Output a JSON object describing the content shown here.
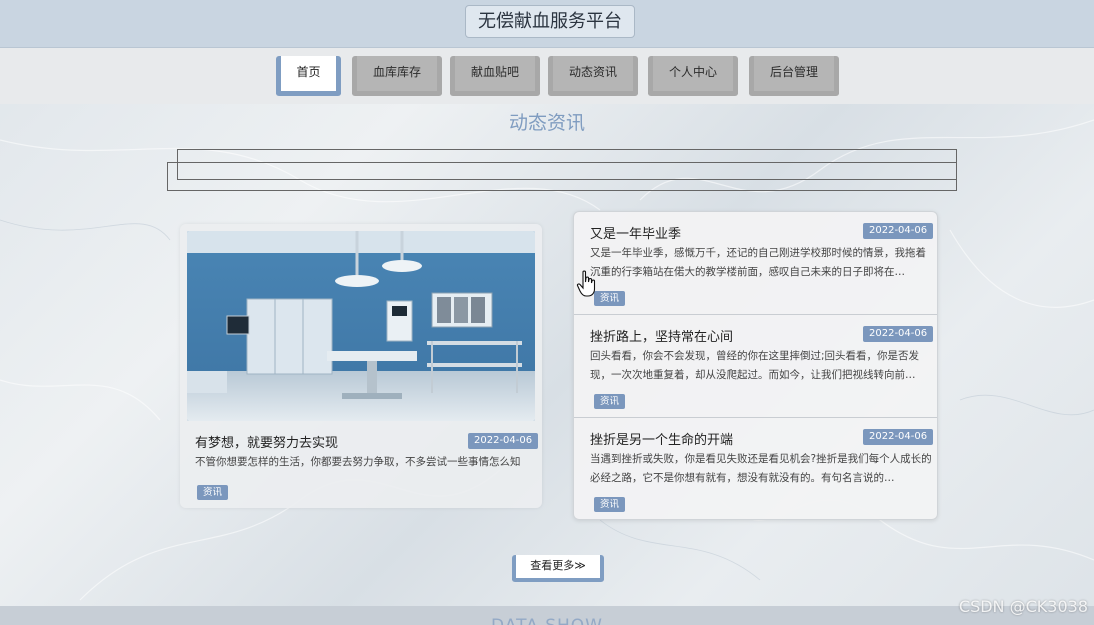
{
  "header": {
    "site_title": "无偿献血服务平台"
  },
  "nav": {
    "items": [
      {
        "label": "首页",
        "active": true
      },
      {
        "label": "血库库存",
        "active": false
      },
      {
        "label": "献血贴吧",
        "active": false
      },
      {
        "label": "动态资讯",
        "active": false
      },
      {
        "label": "个人中心",
        "active": false
      },
      {
        "label": "后台管理",
        "active": false
      }
    ]
  },
  "news": {
    "section_title": "动态资讯",
    "featured": {
      "title": "有梦想，就要努力去实现",
      "date": "2022-04-06",
      "summary": "不管你想要怎样的生活，你都要去努力争取，不多尝试一些事情怎么知",
      "tag": "资讯",
      "image": "operating-room-photo"
    },
    "list": [
      {
        "title": "又是一年毕业季",
        "date": "2022-04-06",
        "summary": "又是一年毕业季，感慨万千，还记的自己刚进学校那时候的情景，我拖着沉重的行李箱站在偌大的教学楼前面，感叹自己未来的日子即将在…",
        "tag": "资讯"
      },
      {
        "title": "挫折路上，坚持常在心间",
        "date": "2022-04-06",
        "summary": "回头看看，你会不会发现，曾经的你在这里摔倒过;回头看看，你是否发现，一次次地重复着，却从没爬起过。而如今，让我们把视线转向前…",
        "tag": "资讯"
      },
      {
        "title": "挫折是另一个生命的开端",
        "date": "2022-04-06",
        "summary": "当遇到挫折或失败，你是看见失败还是看见机会?挫折是我们每个人成长的必经之路，它不是你想有就有，想没有就没有的。有句名言说的…",
        "tag": "资讯"
      }
    ],
    "more_label": "查看更多≫"
  },
  "footer": {
    "section_title": "DATA SHOW"
  },
  "watermark": "CSDN @CK3038",
  "colors": {
    "accent": "#7b97bd",
    "nav_inactive": "#b5b5b5",
    "header_bg": "#c9d5e1"
  }
}
